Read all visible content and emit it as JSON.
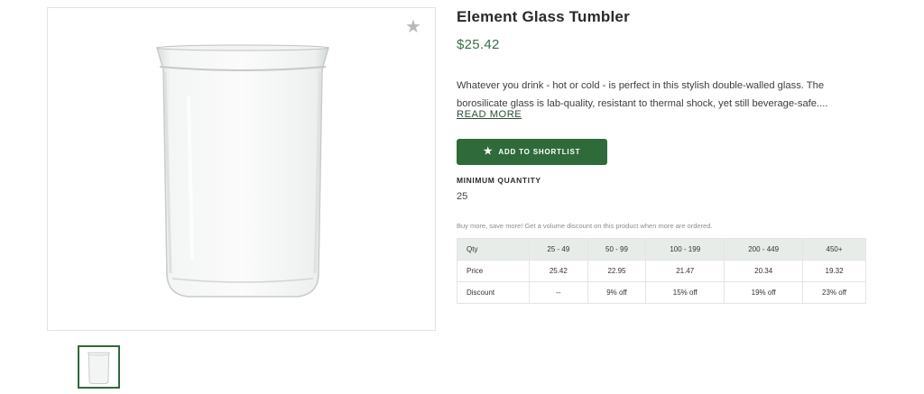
{
  "product": {
    "title": "Element Glass Tumbler",
    "price": "$25.42",
    "description": "Whatever you drink - hot or cold - is perfect in this stylish double-walled glass. The borosilicate glass is lab-quality, resistant to thermal shock, yet still beverage-safe....",
    "read_more": "READ MORE",
    "shortlist_button": "ADD TO SHORTLIST",
    "min_quantity_label": "MINIMUM QUANTITY",
    "min_quantity_value": "25",
    "volume_note": "Buy more, save more! Get a volume discount on this product when more are ordered."
  },
  "icons": {
    "favorite": "star-icon",
    "button": "star-icon"
  },
  "colors": {
    "brand_green": "#2f6b3a",
    "price_green": "#3a6f45",
    "table_header_bg": "#e8ece9",
    "star_gray": "#b9b9b9"
  },
  "pricing_table": {
    "headers": [
      "Qty",
      "25 - 49",
      "50 - 99",
      "100 - 199",
      "200 - 449",
      "450+"
    ],
    "rows": [
      [
        "Price",
        "25.42",
        "22.95",
        "21.47",
        "20.34",
        "19.32"
      ],
      [
        "Discount",
        "--",
        "9% off",
        "15% off",
        "19% off",
        "23% off"
      ]
    ]
  }
}
